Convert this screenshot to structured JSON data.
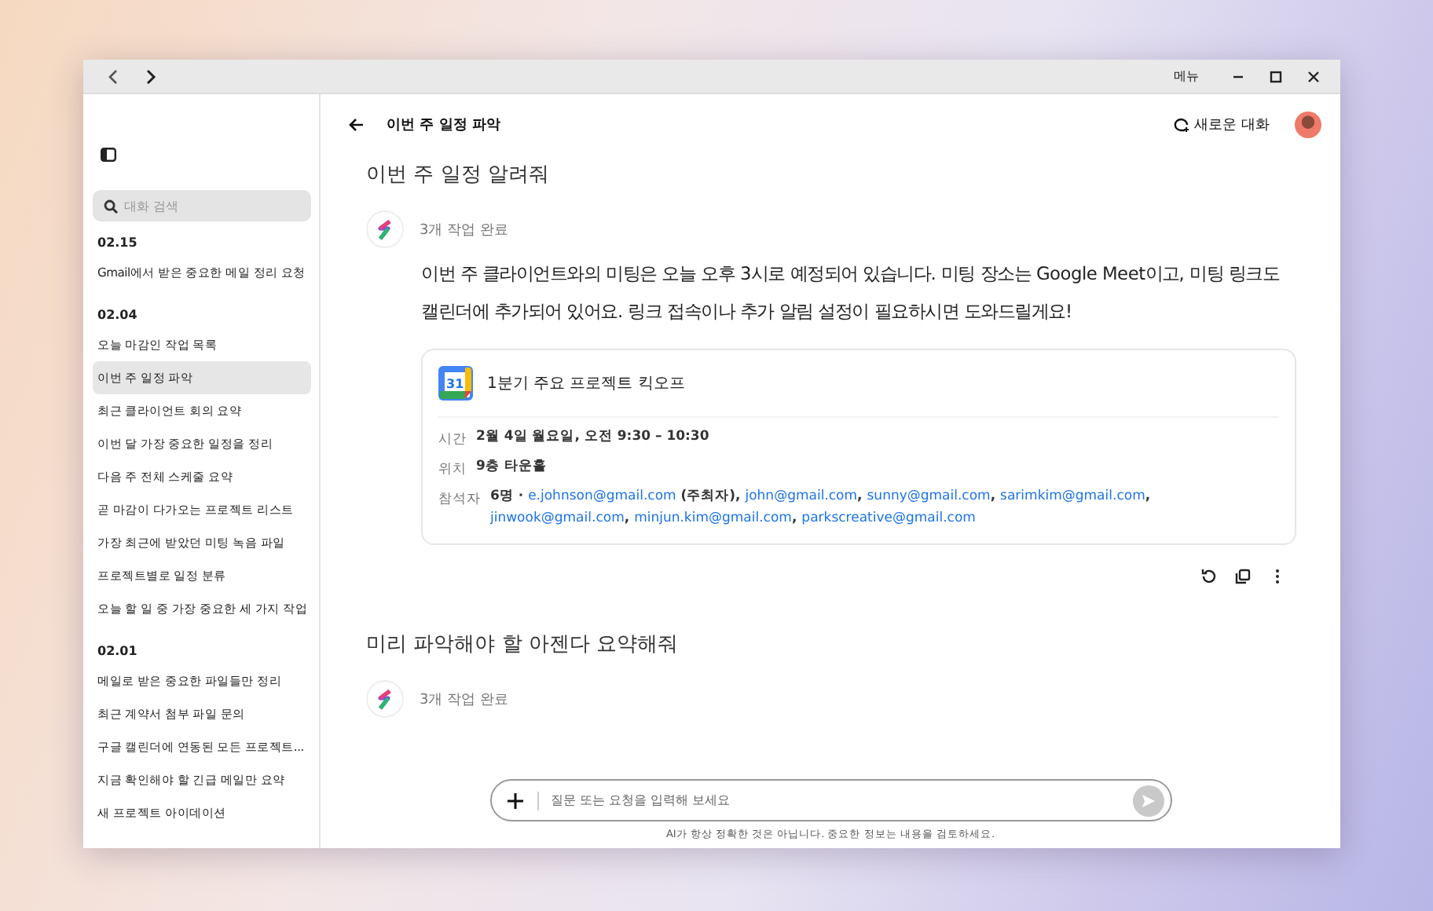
{
  "window": {
    "menu_label": "메뉴"
  },
  "sidebar": {
    "search": {
      "placeholder": "대화 검색"
    },
    "groups": [
      {
        "date": "02.15",
        "items": [
          {
            "label": "Gmail에서 받은 중요한 메일 정리 요청",
            "selected": false
          }
        ]
      },
      {
        "date": "02.04",
        "items": [
          {
            "label": "오늘 마감인 작업 목록",
            "selected": false
          },
          {
            "label": "이번 주 일정 파악",
            "selected": true
          },
          {
            "label": "최근 클라이언트 회의 요약",
            "selected": false
          },
          {
            "label": "이번 달 가장 중요한 일정을 정리",
            "selected": false
          },
          {
            "label": "다음 주 전체 스케줄 요약",
            "selected": false
          },
          {
            "label": "곧 마감이 다가오는 프로젝트 리스트",
            "selected": false
          },
          {
            "label": "가장 최근에 받았던 미팅 녹음 파일",
            "selected": false
          },
          {
            "label": "프로젝트별로 일정 분류",
            "selected": false
          },
          {
            "label": "오늘 할 일 중 가장 중요한 세 가지 작업",
            "selected": false
          }
        ]
      },
      {
        "date": "02.01",
        "items": [
          {
            "label": "메일로 받은 중요한 파일들만 정리",
            "selected": false
          },
          {
            "label": "최근 계약서 첨부 파일 문의",
            "selected": false
          },
          {
            "label": "구글 캘린더에 연동된 모든 프로젝트...",
            "selected": false
          },
          {
            "label": "지금 확인해야 할 긴급 메일만 요약",
            "selected": false
          },
          {
            "label": "새 프로젝트 아이데이션",
            "selected": false
          }
        ]
      }
    ]
  },
  "header": {
    "title": "이번 주 일정 파악",
    "new_chat": "새로운 대화"
  },
  "conversation": [
    {
      "kind": "user",
      "text": "이번 주 일정 알려줘"
    },
    {
      "kind": "assistant",
      "status": "3개 작업 완료",
      "text": "이번 주 클라이언트와의 미팅은 오늘 오후 3시로 예정되어 있습니다. 미팅 장소는 Google Meet이고, 미팅 링크도 캘린더에 추가되어 있어요. 링크 접속이나 추가 알림 설정이 필요하시면 도와드릴게요!",
      "event": {
        "icon_text": "31",
        "title": "1분기 주요 프로젝트 킥오프",
        "rows": [
          {
            "kind": "text",
            "label": "시간",
            "value": "2월 4일 월요일, 오전 9:30 – 10:30"
          },
          {
            "kind": "text",
            "label": "위치",
            "value": "9층 타운홀"
          },
          {
            "kind": "attendees",
            "label": "참석자",
            "count": "6명 · ",
            "attendees": [
              {
                "email": "e.johnson@gmail.com",
                "after": " (주최자), "
              },
              {
                "email": "john@gmail.com",
                "after": ", "
              },
              {
                "email": "sunny@gmail.com",
                "after": ", "
              },
              {
                "email": "sarimkim@gmail.com",
                "after": ", "
              },
              {
                "email": "jinwook@gmail.com",
                "after": ", "
              },
              {
                "email": "minjun.kim@gmail.com",
                "after": ", "
              },
              {
                "email": "parkscreative@gmail.com"
              }
            ]
          }
        ]
      },
      "actions": true
    },
    {
      "kind": "user",
      "text": "미리 파악해야 할 아젠다 요약해줘"
    },
    {
      "kind": "assistant",
      "status": "3개 작업 완료",
      "actions": false
    }
  ],
  "composer": {
    "placeholder": "질문 또는 요청을 입력해 보세요",
    "disclaimer": "AI가 항상 정확한 것은 아닙니다. 중요한 정보는 내용을 검토하세요."
  }
}
